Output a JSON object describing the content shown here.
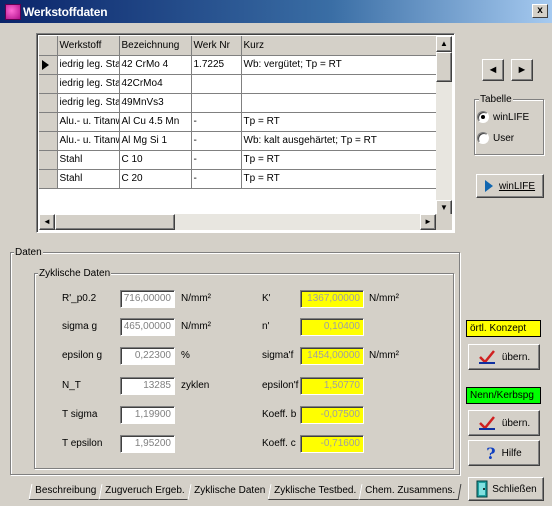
{
  "window": {
    "title": "Werkstoffdaten",
    "close": "x"
  },
  "table": {
    "columns": [
      "Werkstoff",
      "Bezeichnung",
      "Werk Nr",
      "Kurz"
    ],
    "rows": [
      [
        "iedrig leg. Stahl",
        "42 CrMo 4",
        "1.7225",
        "Wb: vergütet; Tp = RT"
      ],
      [
        "iedrig leg. Stahl",
        "42CrMo4",
        "",
        ""
      ],
      [
        "iedrig leg. Stahl",
        "49MnVs3",
        "",
        ""
      ],
      [
        "Alu.- u. Titanwei",
        "Al Cu 4.5 Mn",
        "-",
        "Tp = RT"
      ],
      [
        "Alu.- u. Titanwei",
        "Al Mg Si 1",
        "-",
        "Wb: kalt ausgehärtet; Tp = RT"
      ],
      [
        "Stahl",
        "C 10",
        "-",
        "Tp = RT"
      ],
      [
        "Stahl",
        "C 20",
        "-",
        "Tp = RT"
      ]
    ]
  },
  "nav": {
    "prev": "◄",
    "next": "►"
  },
  "tabelle": {
    "label": "Tabelle",
    "options": [
      "winLIFE",
      "User"
    ],
    "selected": "winLIFE"
  },
  "winlife_button": "winLIFE",
  "daten": {
    "label": "Daten",
    "zyklische_label": "Zyklische Daten",
    "left": [
      {
        "label": "R'_p0.2",
        "value": "716,00000",
        "unit": "N/mm²"
      },
      {
        "label": "sigma g",
        "value": "465,00000",
        "unit": "N/mm²"
      },
      {
        "label": "epsilon g",
        "value": "0,22300",
        "unit": "%"
      },
      {
        "label": "N_T",
        "value": "13285",
        "unit": "zyklen"
      },
      {
        "label": "T sigma",
        "value": "1,19900",
        "unit": ""
      },
      {
        "label": "T epsilon",
        "value": "1,95200",
        "unit": ""
      }
    ],
    "right": [
      {
        "label": "K'",
        "value": "1367,00000",
        "unit": "N/mm²"
      },
      {
        "label": "n'",
        "value": "0,10400",
        "unit": ""
      },
      {
        "label": "sigma'f",
        "value": "1454,00000",
        "unit": "N/mm²"
      },
      {
        "label": "epsilon'f",
        "value": "1,50770",
        "unit": ""
      },
      {
        "label": "Koeff. b",
        "value": "-0,07500",
        "unit": ""
      },
      {
        "label": "Koeff. c",
        "value": "-0,71600",
        "unit": ""
      }
    ]
  },
  "side": {
    "oertl": "örtl. Konzept",
    "uebern1": "übern.",
    "nenn": "Nenn/Kerbspg",
    "uebern2": "übern.",
    "hilfe": "Hilfe",
    "schliessen": "Schließen"
  },
  "tabs": [
    "Beschreibung",
    "Zugveruch Ergeb.",
    "Zyklische Daten",
    "Zyklische Testbed.",
    "Chem. Zusammens."
  ],
  "active_tab": "Zyklische Daten",
  "colors": {
    "highlight": "#ffff00",
    "titlebar": "#0a246a",
    "badge1": "#ffff00",
    "badge2": "#00ff00"
  }
}
